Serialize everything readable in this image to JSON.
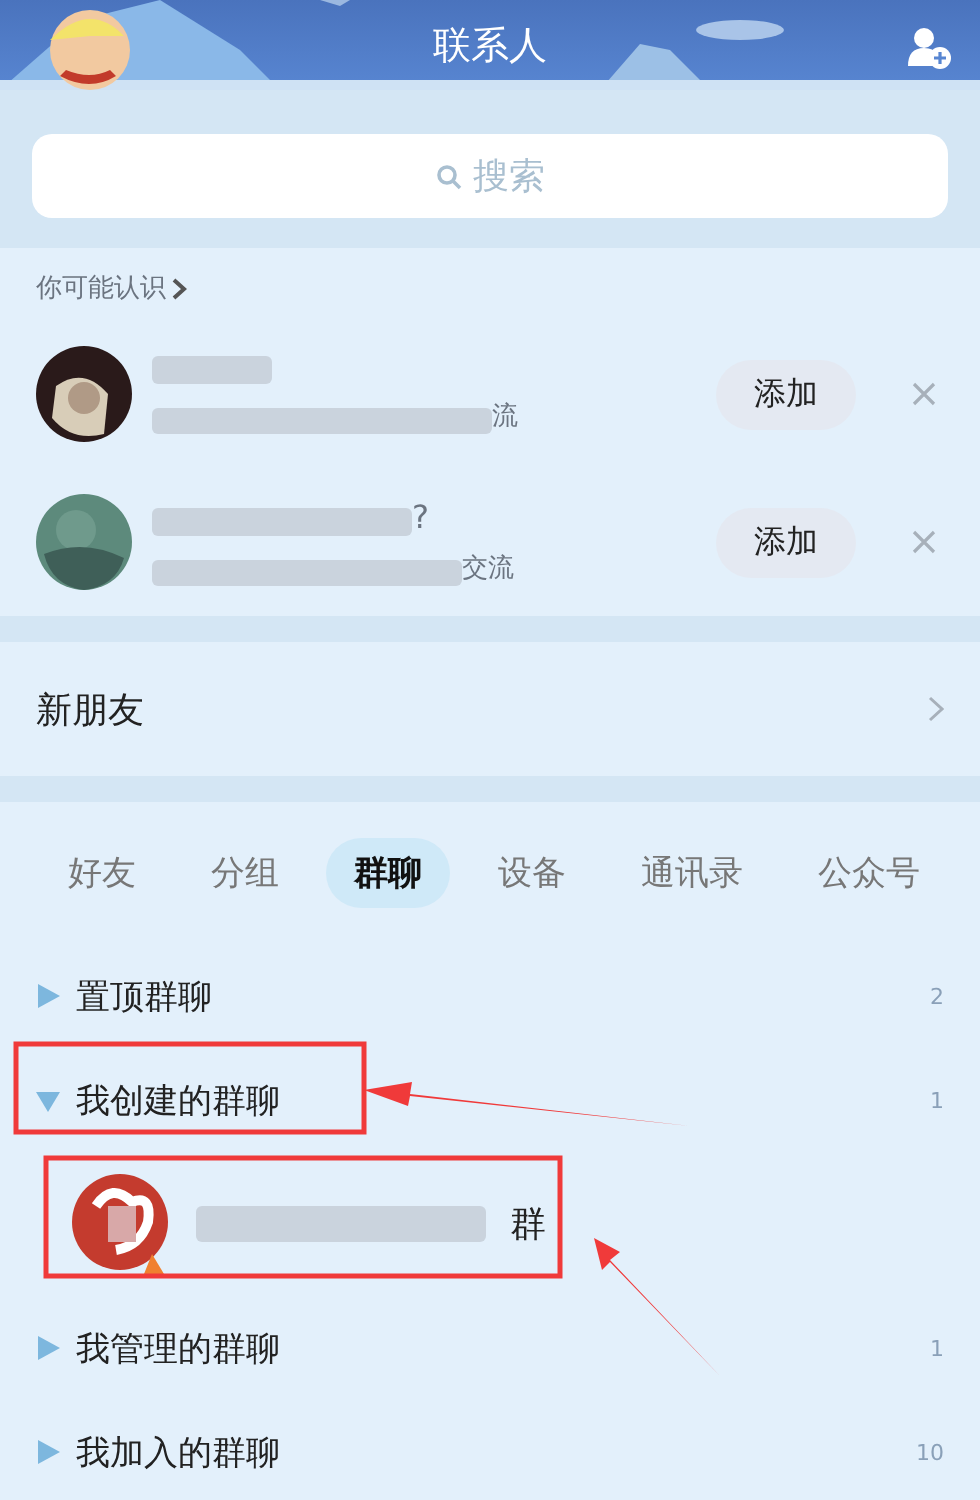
{
  "header": {
    "title": "联系人"
  },
  "search": {
    "placeholder": "搜索"
  },
  "suggestions": {
    "heading": "你可能认识",
    "people": [
      {
        "desc_tail": "流",
        "button": "添加"
      },
      {
        "name_tail": "?",
        "desc_tail": "交流",
        "button": "添加"
      }
    ]
  },
  "new_friends": {
    "label": "新朋友"
  },
  "tabs": [
    {
      "label": "好友",
      "selected": false
    },
    {
      "label": "分组",
      "selected": false
    },
    {
      "label": "群聊",
      "selected": true
    },
    {
      "label": "设备",
      "selected": false
    },
    {
      "label": "通讯录",
      "selected": false
    },
    {
      "label": "公众号",
      "selected": false
    }
  ],
  "groups": [
    {
      "label": "置顶群聊",
      "count": "2",
      "expanded": false
    },
    {
      "label": "我创建的群聊",
      "count": "1",
      "expanded": true,
      "children": [
        {
          "name_tail": "群"
        }
      ]
    },
    {
      "label": "我管理的群聊",
      "count": "1",
      "expanded": false
    },
    {
      "label": "我加入的群聊",
      "count": "10",
      "expanded": false
    }
  ]
}
